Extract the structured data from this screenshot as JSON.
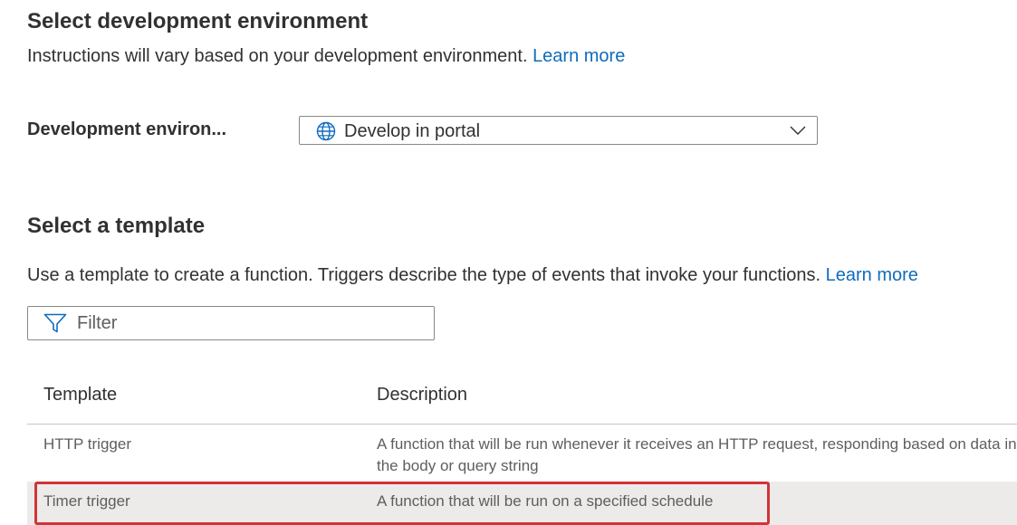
{
  "environment_section": {
    "title": "Select development environment",
    "description": "Instructions will vary based on your development environment.",
    "learn_more": "Learn more",
    "field_label": "Development environ...",
    "dropdown_value": "Develop in portal"
  },
  "template_section": {
    "title": "Select a template",
    "description": "Use a template to create a function. Triggers describe the type of events that invoke your functions.",
    "learn_more": "Learn more",
    "filter_placeholder": "Filter",
    "columns": {
      "template": "Template",
      "description": "Description"
    },
    "rows": [
      {
        "name": "HTTP trigger",
        "description": "A function that will be run whenever it receives an HTTP request, responding based on data in the body or query string"
      },
      {
        "name": "Timer trigger",
        "description": "A function that will be run on a specified schedule"
      }
    ]
  },
  "colors": {
    "link": "#0f6cbd",
    "selected_row_bg": "#edebe9",
    "highlight_border": "#d13438"
  },
  "icons": {
    "dropdown_leading": "globe-icon",
    "dropdown_trailing": "chevron-down-icon",
    "filter_leading": "filter-icon"
  }
}
